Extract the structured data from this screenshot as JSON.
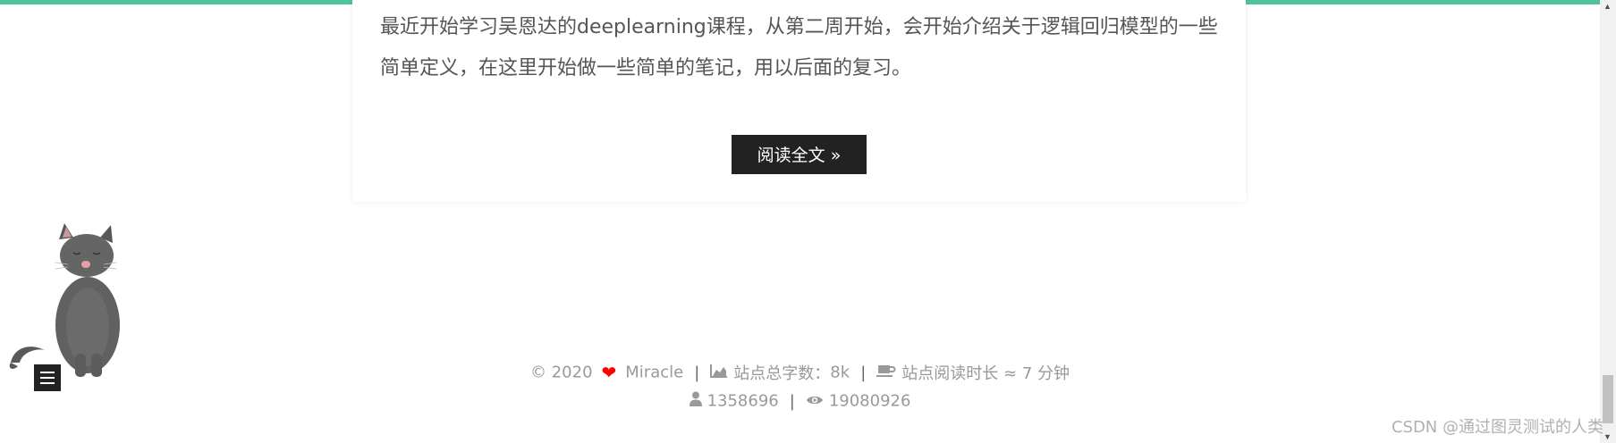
{
  "post": {
    "excerpt": "最近开始学习吴恩达的deeplearning课程，从第二周开始，会开始介绍关于逻辑回归模型的一些简单定义，在这里开始做一些简单的笔记，用以后面的复习。",
    "read_more_label": "阅读全文 »"
  },
  "footer": {
    "copyright": "© 2020",
    "author": "Miracle",
    "separator": "|",
    "word_count_label": "站点总字数：",
    "word_count_value": "8k",
    "read_time_label": "站点阅读时长 ≈",
    "read_time_value": "7 分钟",
    "visitors": "1358696",
    "views": "19080926"
  },
  "icons": {
    "heart": "heart-icon",
    "chart": "area-chart-icon",
    "coffee": "coffee-icon",
    "user": "user-icon",
    "eye": "eye-icon",
    "menu": "menu-icon"
  },
  "colors": {
    "accent_bar": "#4ec3a0",
    "heart": "#ff0000",
    "button_bg": "#222222",
    "footer_text": "#999999"
  },
  "watermark": "CSDN @通过图灵测试的人类"
}
